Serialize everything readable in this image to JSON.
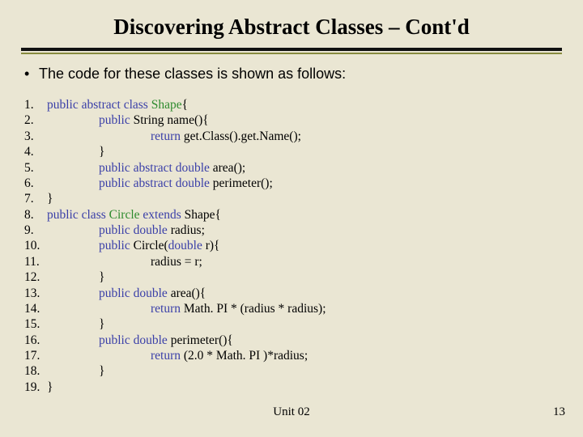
{
  "title": "Discovering Abstract Classes – Cont'd",
  "bullet": "The code for these classes is shown as follows:",
  "footer": {
    "unit": "Unit 02",
    "page": "13"
  },
  "code": [
    {
      "n": "1.",
      "indent": 0,
      "segs": [
        {
          "t": "public ",
          "k": true
        },
        {
          "t": "abstract ",
          "k": true
        },
        {
          "t": "class ",
          "k": true
        },
        {
          "t": "Shape",
          "c": true
        },
        {
          "t": "{"
        }
      ]
    },
    {
      "n": "2.",
      "indent": 2,
      "segs": [
        {
          "t": "public ",
          "k": true
        },
        {
          "t": "String name(){"
        }
      ]
    },
    {
      "n": "3.",
      "indent": 4,
      "segs": [
        {
          "t": "return ",
          "k": true
        },
        {
          "t": "get.Class().get.Name();"
        }
      ]
    },
    {
      "n": "4.",
      "indent": 2,
      "segs": [
        {
          "t": "}"
        }
      ]
    },
    {
      "n": "5.",
      "indent": 2,
      "segs": [
        {
          "t": "public ",
          "k": true
        },
        {
          "t": "abstract ",
          "k": true
        },
        {
          "t": "double ",
          "k": true
        },
        {
          "t": "area();"
        }
      ]
    },
    {
      "n": "6.",
      "indent": 2,
      "segs": [
        {
          "t": "public ",
          "k": true
        },
        {
          "t": "abstract ",
          "k": true
        },
        {
          "t": "double ",
          "k": true
        },
        {
          "t": "perimeter();"
        }
      ]
    },
    {
      "n": "7.",
      "indent": 0,
      "segs": [
        {
          "t": "}"
        }
      ]
    },
    {
      "n": "8.",
      "indent": 0,
      "segs": [
        {
          "t": "public ",
          "k": true
        },
        {
          "t": "class ",
          "k": true
        },
        {
          "t": "Circle ",
          "c": true
        },
        {
          "t": "extends ",
          "k": true
        },
        {
          "t": "Shape{"
        }
      ]
    },
    {
      "n": "9.",
      "indent": 2,
      "segs": [
        {
          "t": "public ",
          "k": true
        },
        {
          "t": "double ",
          "k": true
        },
        {
          "t": "radius;"
        }
      ]
    },
    {
      "n": "10.",
      "indent": 2,
      "segs": [
        {
          "t": "public  ",
          "k": true
        },
        {
          "t": "Circle(",
          "c": false
        },
        {
          "t": "double ",
          "k": true
        },
        {
          "t": "r){"
        }
      ]
    },
    {
      "n": "11.",
      "indent": 4,
      "segs": [
        {
          "t": "radius = r;"
        }
      ]
    },
    {
      "n": "12.",
      "indent": 2,
      "segs": [
        {
          "t": "}"
        }
      ]
    },
    {
      "n": "13.",
      "indent": 2,
      "segs": [
        {
          "t": "public ",
          "k": true
        },
        {
          "t": "double ",
          "k": true
        },
        {
          "t": "area(){"
        }
      ]
    },
    {
      "n": "14.",
      "indent": 4,
      "segs": [
        {
          "t": "return ",
          "k": true
        },
        {
          "t": "Math. PI * (radius * radius);"
        }
      ]
    },
    {
      "n": "15.",
      "indent": 2,
      "segs": [
        {
          "t": "}"
        }
      ]
    },
    {
      "n": "16.",
      "indent": 2,
      "segs": [
        {
          "t": "public ",
          "k": true
        },
        {
          "t": "double ",
          "k": true
        },
        {
          "t": "perimeter(){"
        }
      ]
    },
    {
      "n": "17.",
      "indent": 4,
      "segs": [
        {
          "t": "return ",
          "k": true
        },
        {
          "t": "(2.0 * Math. PI )*radius;"
        }
      ]
    },
    {
      "n": "18.",
      "indent": 2,
      "segs": [
        {
          "t": "}"
        }
      ]
    },
    {
      "n": "19.",
      "indent": 0,
      "segs": [
        {
          "t": "}"
        }
      ]
    }
  ]
}
